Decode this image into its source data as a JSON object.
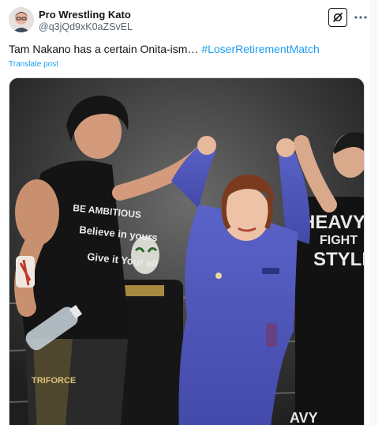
{
  "post": {
    "author": {
      "display_name": "Pro Wrestling Kato",
      "handle": "@q3jQd9xK0aZSvEL"
    },
    "text": "Tam Nakano has a certain Onita-ism… ",
    "hashtag": "#LoserRetirementMatch",
    "translate_label": "Translate post"
  },
  "icons": {
    "grok": "grok-icon",
    "more": "more-dots-icon"
  },
  "colors": {
    "link": "#1d9bf0",
    "text_primary": "#0f1419",
    "text_secondary": "#536471"
  },
  "media": {
    "shirt_left_lines": [
      "BE AMBITIOUS",
      "Believe in yours",
      "Give it Your all"
    ],
    "shirt_right_lines": [
      "HEAVY",
      "FIGHT",
      "STYLE"
    ],
    "shirt_bottom": "AVY",
    "bottle_text": "TRIFORCE"
  }
}
